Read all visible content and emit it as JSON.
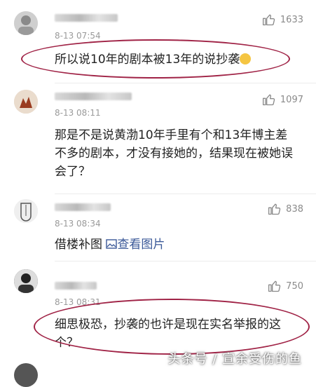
{
  "comments": [
    {
      "likes": "1633",
      "time": "8-13 07:54",
      "text": "所以说10年的剧本被13年的说抄袭",
      "emoji": "sweat-smile-emoji"
    },
    {
      "likes": "1097",
      "time": "8-13 08:11",
      "text": "那是不是说黄渤10年手里有个和13年博主差不多的剧本，才没有接她的，结果现在被她误会了？"
    },
    {
      "likes": "838",
      "time": "8-13 08:34",
      "text": "借楼补图",
      "link_text": "查看图片"
    },
    {
      "likes": "750",
      "time": "8-13 08:31",
      "text": "细思极恐，抄袭的也许是现在实名举报的这个？"
    }
  ],
  "watermark": "头条号 / 宣余受伤的鱼",
  "colors": {
    "annotation_oval": "#a02346",
    "text": "#222222",
    "meta": "#9a9a9a",
    "link": "#3b5998"
  }
}
